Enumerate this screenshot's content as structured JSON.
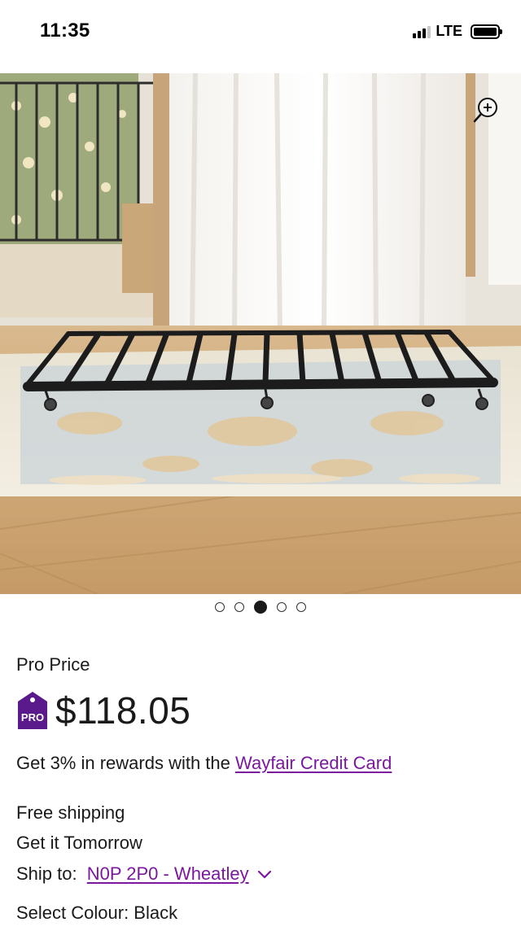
{
  "status_bar": {
    "time": "11:35",
    "network": "LTE"
  },
  "product": {
    "image_alt": "Metal trundle bed frame on rug",
    "carousel": {
      "total": 5,
      "active_index": 2
    }
  },
  "pricing": {
    "label": "Pro Price",
    "badge_text": "PRO",
    "price": "$118.05"
  },
  "rewards": {
    "prefix": "Get 3% in rewards with the ",
    "link_text": "Wayfair Credit Card"
  },
  "shipping": {
    "free_shipping": "Free shipping",
    "delivery": "Get it Tomorrow",
    "ship_to_label": "Ship to: ",
    "ship_to_location": "N0P 2P0 - Wheatley"
  },
  "colour": {
    "label": "Select Colour: ",
    "value": "Black"
  },
  "colors": {
    "link": "#7b189f",
    "pro_badge": "#5a1a8c"
  },
  "icons": {
    "zoom": "zoom-in-icon",
    "chevron": "chevron-down-icon"
  }
}
